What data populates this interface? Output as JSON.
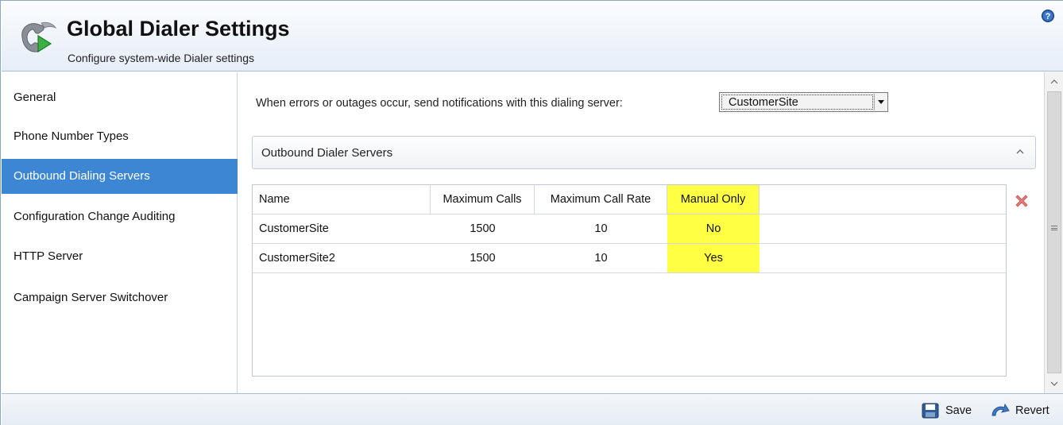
{
  "header": {
    "title": "Global Dialer Settings",
    "subtitle": "Configure system-wide Dialer settings",
    "app_icon": "phone-play-icon",
    "help_icon": "help-icon"
  },
  "sidebar": {
    "items": [
      {
        "label": "General",
        "active": false
      },
      {
        "label": "Phone Number Types",
        "active": false
      },
      {
        "label": "Outbound Dialing Servers",
        "active": true
      },
      {
        "label": "Configuration Change Auditing",
        "active": false
      },
      {
        "label": "HTTP Server",
        "active": false
      },
      {
        "label": "Campaign Server Switchover",
        "active": false
      }
    ]
  },
  "main": {
    "notification_label": "When errors or outages occur, send notifications with this dialing server:",
    "notification_server": "CustomerSite",
    "group_title": "Outbound Dialer Servers",
    "table": {
      "columns": [
        "Name",
        "Maximum Calls",
        "Maximum Call Rate",
        "Manual Only"
      ],
      "rows": [
        {
          "name": "CustomerSite",
          "max_calls": "1500",
          "max_call_rate": "10",
          "manual_only": "No"
        },
        {
          "name": "CustomerSite2",
          "max_calls": "1500",
          "max_call_rate": "10",
          "manual_only": "Yes"
        }
      ]
    },
    "highlight_color": "#ffff44",
    "accent_color": "#3d86d3"
  },
  "footer": {
    "save_label": "Save",
    "revert_label": "Revert"
  }
}
